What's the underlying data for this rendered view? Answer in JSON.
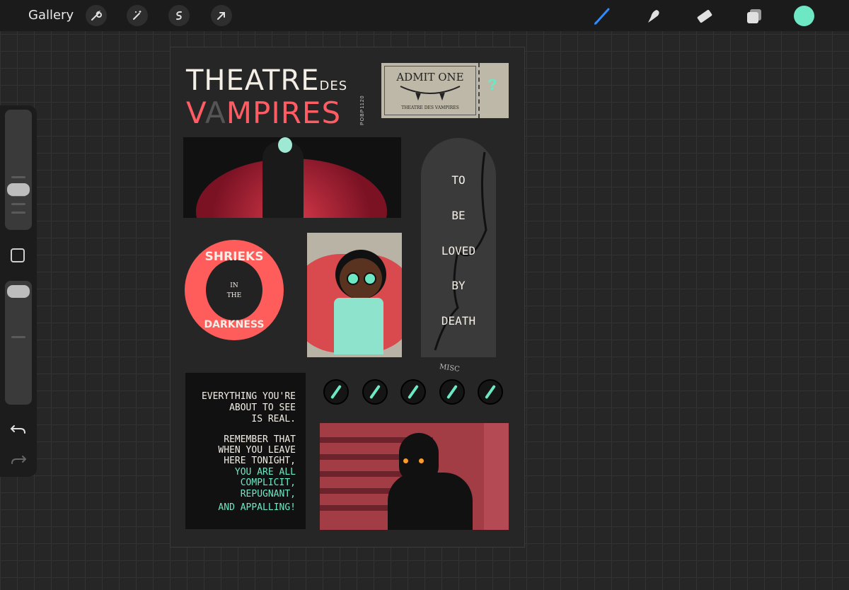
{
  "app": {
    "gallery_label": "Gallery",
    "left_tools": [
      "wrench-icon",
      "magic-wand-icon",
      "selection-s-icon",
      "transform-arrow-icon"
    ],
    "right_tools": [
      "brush-icon",
      "smudge-icon",
      "eraser-icon",
      "layers-icon",
      "color-swatch-icon"
    ],
    "active_tool": "brush-icon",
    "current_color": "#6ee8c4"
  },
  "sidebar": {
    "brush_size_level": 0.55,
    "opacity_level": 1.0,
    "buttons": [
      "modifier-button",
      "undo-icon",
      "redo-icon"
    ]
  },
  "artwork": {
    "title_line1": "THEATRE",
    "title_des": "DES",
    "title_v": "V",
    "title_a": "A",
    "title_rest": "MPIRES",
    "artist_tag": "POBP1120",
    "ticket": {
      "admit": "ADMIT ONE",
      "subtitle": "THEATRE DES VAMPIRES",
      "stub_mark": "?"
    },
    "arch_words": [
      "TO",
      "BE",
      "LOVED",
      "BY",
      "DEATH"
    ],
    "mouth": {
      "top_word": "SHRIEKS",
      "in": "IN",
      "the": "THE",
      "bottom_word": "DARKNESS"
    },
    "quote_lines_white": [
      "EVERYTHING YOU'RE",
      "ABOUT TO SEE",
      "IS REAL.",
      "",
      "REMEMBER THAT",
      "WHEN YOU LEAVE",
      "HERE TONIGHT,"
    ],
    "quote_lines_teal": [
      "YOU ARE ALL",
      "COMPLICIT,",
      "REPUGNANT,",
      "AND APPALLING!"
    ],
    "misc_label": "MISC",
    "misc_count": 5,
    "palette": {
      "red": "#ff5c63",
      "teal": "#6ee8c4",
      "cream": "#f4efe6",
      "dark": "#111111"
    }
  }
}
